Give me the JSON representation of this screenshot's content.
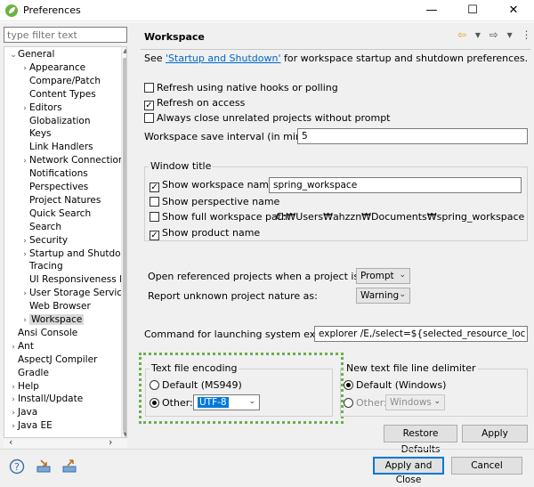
{
  "window": {
    "title": "Preferences",
    "min": "—",
    "max": "☐",
    "close": "✕"
  },
  "filter": {
    "placeholder": "type filter text"
  },
  "tree": [
    {
      "label": "General",
      "level": 0,
      "expander": "⌄"
    },
    {
      "label": "Appearance",
      "level": 1,
      "expander": "›"
    },
    {
      "label": "Compare/Patch",
      "level": 1,
      "expander": ""
    },
    {
      "label": "Content Types",
      "level": 1,
      "expander": ""
    },
    {
      "label": "Editors",
      "level": 1,
      "expander": "›"
    },
    {
      "label": "Globalization",
      "level": 1,
      "expander": ""
    },
    {
      "label": "Keys",
      "level": 1,
      "expander": ""
    },
    {
      "label": "Link Handlers",
      "level": 1,
      "expander": ""
    },
    {
      "label": "Network Connection",
      "level": 1,
      "expander": "›"
    },
    {
      "label": "Notifications",
      "level": 1,
      "expander": ""
    },
    {
      "label": "Perspectives",
      "level": 1,
      "expander": ""
    },
    {
      "label": "Project Natures",
      "level": 1,
      "expander": ""
    },
    {
      "label": "Quick Search",
      "level": 1,
      "expander": ""
    },
    {
      "label": "Search",
      "level": 1,
      "expander": ""
    },
    {
      "label": "Security",
      "level": 1,
      "expander": "›"
    },
    {
      "label": "Startup and Shutdow",
      "level": 1,
      "expander": "›"
    },
    {
      "label": "Tracing",
      "level": 1,
      "expander": ""
    },
    {
      "label": "UI Responsiveness M",
      "level": 1,
      "expander": ""
    },
    {
      "label": "User Storage Service",
      "level": 1,
      "expander": "›"
    },
    {
      "label": "Web Browser",
      "level": 1,
      "expander": ""
    },
    {
      "label": "Workspace",
      "level": 1,
      "expander": "›",
      "selected": true
    },
    {
      "label": "Ansi Console",
      "level": 0,
      "expander": ""
    },
    {
      "label": "Ant",
      "level": 0,
      "expander": "›"
    },
    {
      "label": "AspectJ Compiler",
      "level": 0,
      "expander": ""
    },
    {
      "label": "Gradle",
      "level": 0,
      "expander": ""
    },
    {
      "label": "Help",
      "level": 0,
      "expander": "›"
    },
    {
      "label": "Install/Update",
      "level": 0,
      "expander": "›"
    },
    {
      "label": "Java",
      "level": 0,
      "expander": "›"
    },
    {
      "label": "Java EE",
      "level": 0,
      "expander": "›"
    }
  ],
  "page": {
    "title": "Workspace",
    "see_prefix": "See ",
    "see_link": "'Startup and Shutdown'",
    "see_suffix": " for workspace startup and shutdown preferences.",
    "refresh_native": {
      "label": "Refresh using native hooks or polling",
      "checked": false
    },
    "refresh_access": {
      "label": "Refresh on access",
      "checked": true
    },
    "close_unrelated": {
      "label": "Always close unrelated projects without prompt",
      "checked": false
    },
    "save_interval_label": "Workspace save interval (in minutes):",
    "save_interval_value": "5",
    "window_title_group": "Window title",
    "show_ws_name": {
      "label": "Show workspace name:",
      "checked": true
    },
    "ws_name_value": "spring_workspace",
    "show_perspective": {
      "label": "Show perspective name",
      "checked": false
    },
    "show_path": {
      "label": "Show full workspace path:",
      "checked": false
    },
    "path_value": "C:₩Users₩ahzzn₩Documents₩spring_workspace",
    "show_product": {
      "label": "Show product name",
      "checked": true
    },
    "open_ref_label": "Open referenced projects when a project is opened:",
    "open_ref_value": "Prompt",
    "unknown_nature_label": "Report unknown project nature as:",
    "unknown_nature_value": "Warning",
    "explorer_label": "Command for launching system explorer:",
    "explorer_value": "explorer /E,/select=${selected_resource_loc}",
    "encoding_group": "Text file encoding",
    "encoding_default": "Default (MS949)",
    "encoding_other": "Other:",
    "encoding_value": "UTF-8",
    "delim_group": "New text file line delimiter",
    "delim_default": "Default (Windows)",
    "delim_other": "Other:",
    "delim_value": "Windows",
    "restore_defaults": "Restore Defaults",
    "apply": "Apply"
  },
  "footer": {
    "apply_close": "Apply and Close",
    "cancel": "Cancel"
  },
  "colors": {
    "accent": "#0078d7",
    "highlight_border": "#6ab04c",
    "link": "#0066cc"
  }
}
